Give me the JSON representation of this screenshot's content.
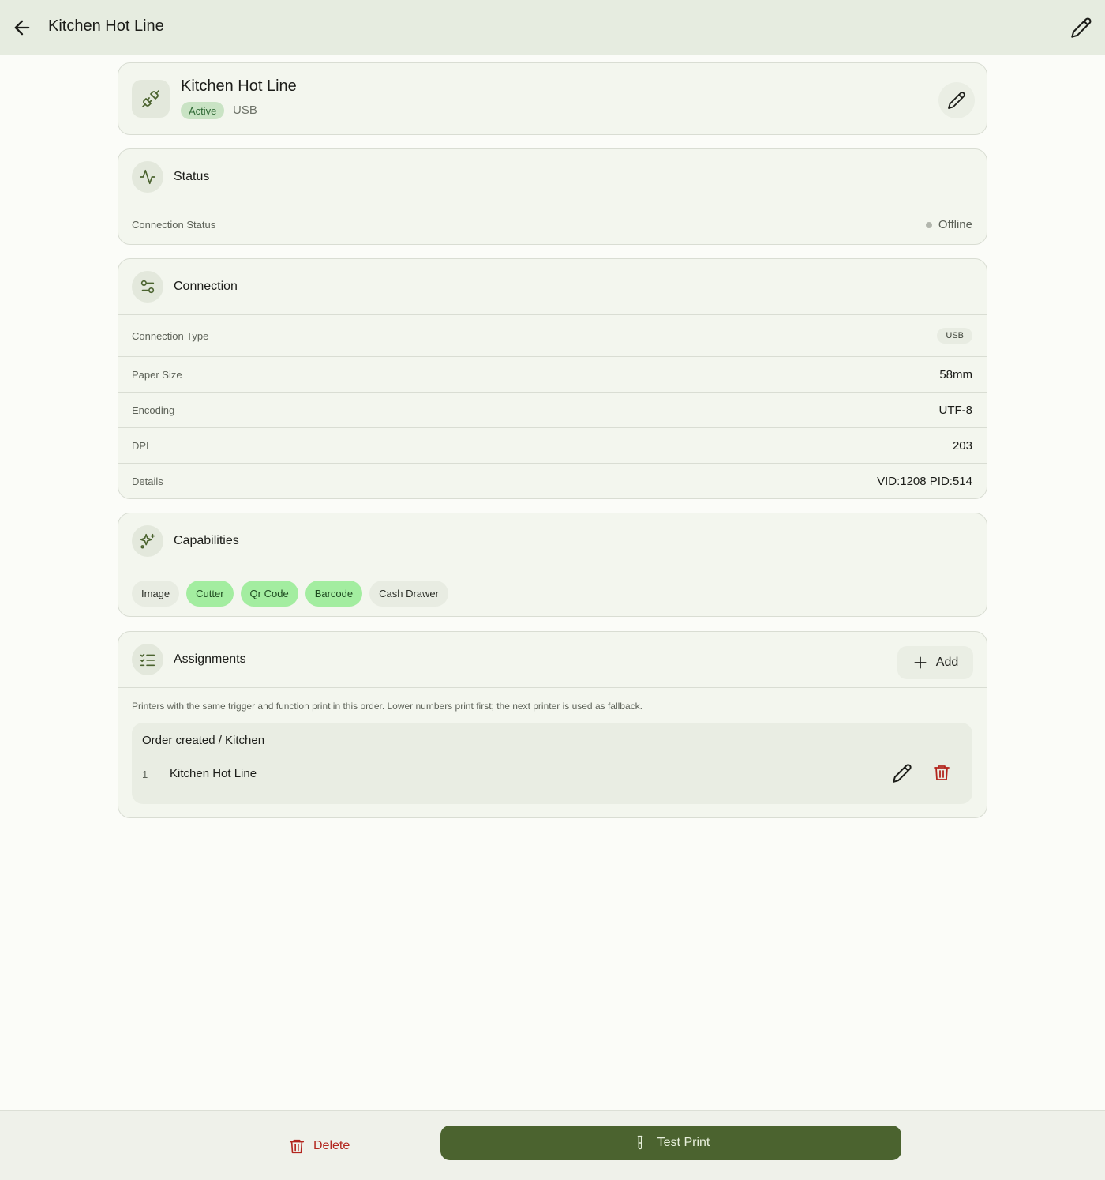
{
  "appbar": {
    "title": "Kitchen Hot Line"
  },
  "printer": {
    "name": "Kitchen Hot Line",
    "status_badge": "Active",
    "connection_type": "USB"
  },
  "status": {
    "title": "Status",
    "rows": [
      {
        "label": "Connection Status",
        "value": "Offline"
      }
    ]
  },
  "connection": {
    "title": "Connection",
    "type_label": "Connection Type",
    "type_value": "USB",
    "rows": [
      {
        "label": "Paper Size",
        "value": "58mm"
      },
      {
        "label": "Encoding",
        "value": "UTF-8"
      },
      {
        "label": "DPI",
        "value": "203"
      },
      {
        "label": "Details",
        "value": "VID:1208 PID:514"
      }
    ]
  },
  "capabilities": {
    "title": "Capabilities",
    "chips": [
      {
        "label": "Image",
        "enabled": false
      },
      {
        "label": "Cutter",
        "enabled": true
      },
      {
        "label": "Qr Code",
        "enabled": true
      },
      {
        "label": "Barcode",
        "enabled": true
      },
      {
        "label": "Cash Drawer",
        "enabled": false
      }
    ]
  },
  "assignments": {
    "title": "Assignments",
    "add_label": "Add",
    "note": "Printers with the same trigger and function print in this order. Lower numbers print first; the next printer is used as fallback.",
    "groups": [
      {
        "title": "Order created / Kitchen",
        "items": [
          {
            "order": "1",
            "name": "Kitchen Hot Line"
          }
        ]
      }
    ]
  },
  "actions": {
    "delete_label": "Delete",
    "test_print_label": "Test Print"
  },
  "colors": {
    "accent": "#4b632f",
    "danger": "#b3261e",
    "chip_enabled": "#a3eda0",
    "badge_active": "#c9e3c4"
  },
  "icons": {
    "back": "arrow-left-icon",
    "edit": "pencil-icon",
    "printer": "plug-icon",
    "status": "activity-icon",
    "connection": "sliders-icon",
    "capabilities": "sparkles-icon",
    "assignments": "checklist-icon",
    "add": "plus-icon",
    "delete": "trash-icon",
    "test_print": "test-tube-icon"
  }
}
